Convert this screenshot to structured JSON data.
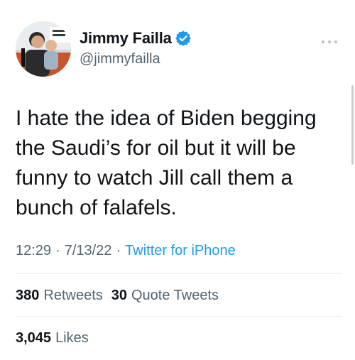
{
  "user": {
    "display_name": "Jimmy Failla",
    "handle": "@jimmyfailla",
    "verified": true,
    "avatar_icon": "avatar-photo"
  },
  "menu": {
    "icon": "more-dots-icon"
  },
  "tweet": {
    "text": "I hate the idea of Biden begging\nthe Saudi’s for oil but it will be\nfunny to watch Jill call them a\nbunch of falafels.",
    "time": "12:29",
    "date": "7/13/22",
    "separator": "·",
    "source": "Twitter for iPhone"
  },
  "stats": {
    "retweets_count": "380",
    "retweets_label": "Retweets",
    "quotes_count": "30",
    "quotes_label": "Quote Tweets",
    "likes_count": "3,045",
    "likes_label": "Likes"
  },
  "colors": {
    "accent": "#1d9bf0",
    "secondary_text": "#536471",
    "primary_text": "#0f1419"
  }
}
